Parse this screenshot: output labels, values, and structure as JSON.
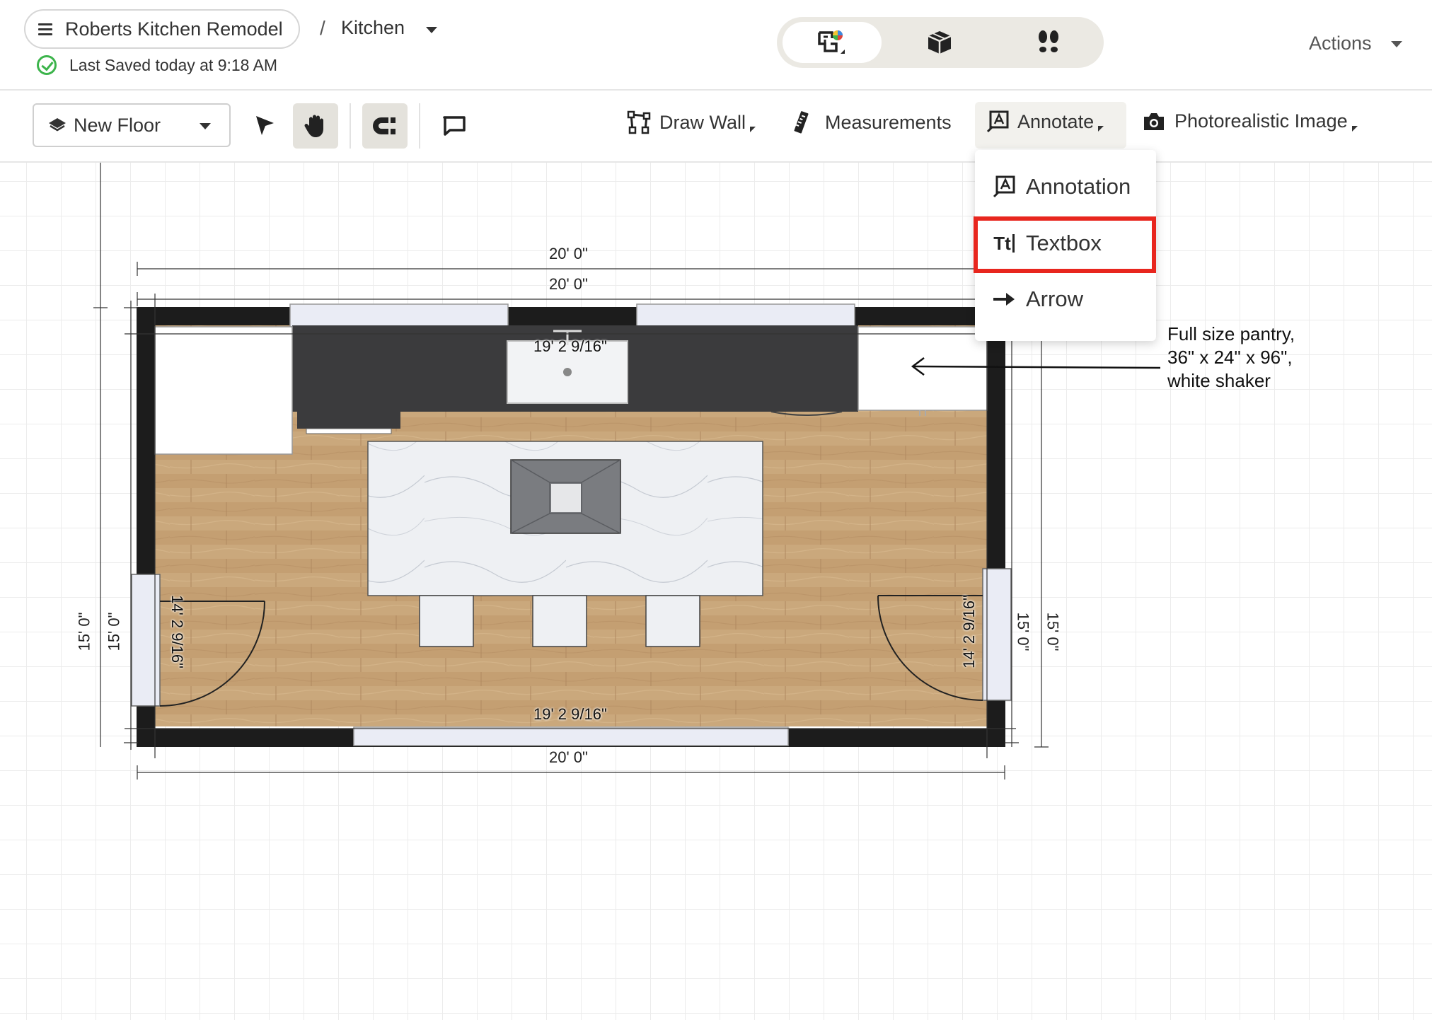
{
  "header": {
    "project_name": "Roberts Kitchen Remodel",
    "breadcrumb_separator": "/",
    "room_name": "Kitchen",
    "saved_status": "Last Saved today at 9:18 AM",
    "actions_label": "Actions",
    "view_modes": [
      "2d-floorplan-icon",
      "3d-box-icon",
      "footsteps-icon"
    ],
    "active_view": "2d-floorplan-icon"
  },
  "toolbar": {
    "floor_select": "New Floor",
    "draw_wall": "Draw Wall",
    "measurements": "Measurements",
    "annotate": "Annotate",
    "photorealistic": "Photorealistic Image",
    "active_tool": "pan-hand",
    "snap_active": true
  },
  "annotate_menu": {
    "items": [
      {
        "label": "Annotation",
        "icon": "annotation-icon"
      },
      {
        "label": "Textbox",
        "icon": "textbox-icon",
        "highlighted": true
      },
      {
        "label": "Arrow",
        "icon": "arrow-right-icon"
      }
    ],
    "textbox_icon_text": "Tt"
  },
  "plan": {
    "top_outer": "20' 0\"",
    "top_inner": "20' 0\"",
    "bottom_outer": "20' 0\"",
    "top_wall_interior": "19' 2 9/16\"",
    "bottom_wall_interior": "19' 2 9/16\"",
    "left_outer": "15' 0\"",
    "left_inner": "15' 0\"",
    "left_interior": "14' 2 9/16\"",
    "right_outer": "15' 0\"",
    "right_inner": "15' 0\"",
    "right_interior": "14' 2 9/16\"",
    "note": [
      "Full size pantry,",
      "36\" x 24\" x 96\",",
      "white shaker"
    ]
  },
  "colors": {
    "accent_highlight": "#e8261e",
    "saved_green": "#3cb44b",
    "wall": "#1c1c1c",
    "floor": "#c8a67a",
    "counter": "#3b3b3d"
  }
}
